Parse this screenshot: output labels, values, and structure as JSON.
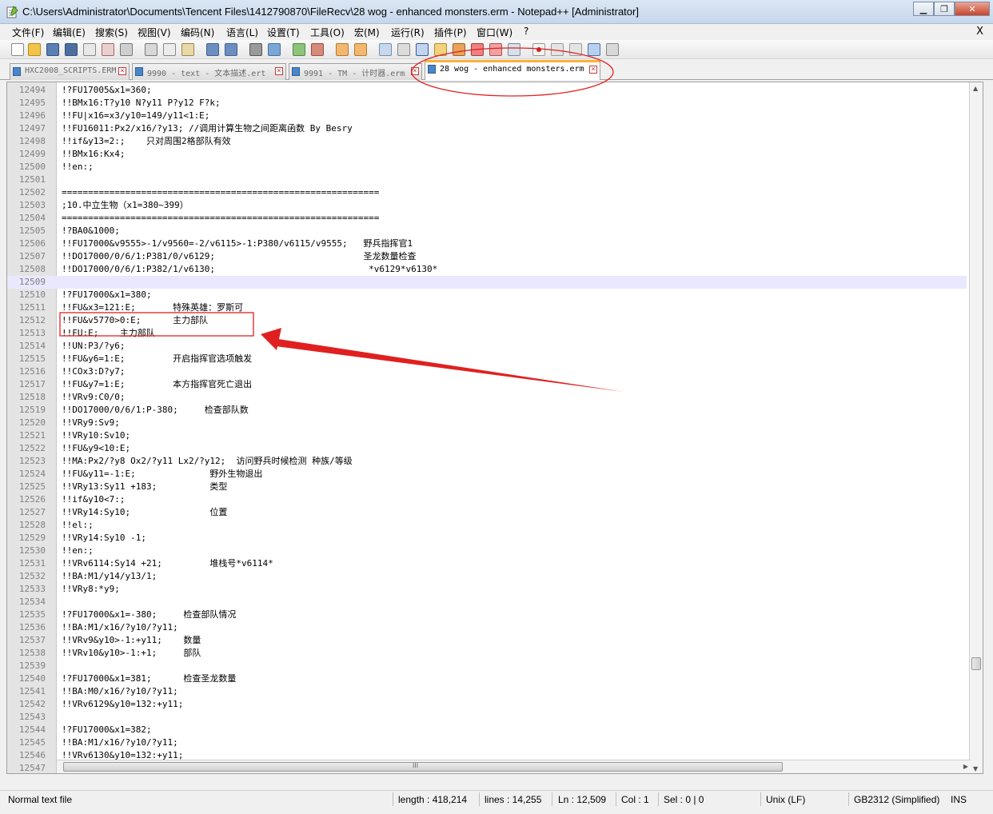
{
  "window": {
    "title": "C:\\Users\\Administrator\\Documents\\Tencent Files\\1412790870\\FileRecv\\28 wog - enhanced monsters.erm - Notepad++ [Administrator]",
    "minimize": "▁",
    "maximize": "❐",
    "close": "✕"
  },
  "menu": {
    "items": [
      "文件(F)",
      "编辑(E)",
      "搜索(S)",
      "视图(V)",
      "编码(N)",
      "语言(L)",
      "设置(T)",
      "工具(O)",
      "宏(M)",
      "运行(R)",
      "插件(P)",
      "窗口(W)",
      "?"
    ],
    "close": "X"
  },
  "tabs": [
    {
      "label": "HXC2008_SCRIPTS.ERM",
      "active": false
    },
    {
      "label": "9990 - text - 文本描述.ert",
      "active": false
    },
    {
      "label": "9991 - TM - 计时器.erm",
      "active": false
    },
    {
      "label": "28 wog - enhanced monsters.erm",
      "active": true
    }
  ],
  "editor": {
    "current_line": 12509,
    "lines": [
      {
        "n": "12494",
        "t": "!?FU17005&x1=360;"
      },
      {
        "n": "12495",
        "t": "!!BMx16:T?y10 N?y11 P?y12 F?k;"
      },
      {
        "n": "12496",
        "t": "!!FU|x16=x3/y10=149/y11<1:E;"
      },
      {
        "n": "12497",
        "t": "!!FU16011:Px2/x16/?y13; //调用计算生物之间距离函数 By Besry"
      },
      {
        "n": "12498",
        "t": "!!if&y13=2:;    只对周围2格部队有效"
      },
      {
        "n": "12499",
        "t": "!!BMx16:Kx4;"
      },
      {
        "n": "12500",
        "t": "!!en:;"
      },
      {
        "n": "12501",
        "t": ""
      },
      {
        "n": "12502",
        "t": "============================================================"
      },
      {
        "n": "12503",
        "t": ";10.中立生物（x1=380~399）"
      },
      {
        "n": "12504",
        "t": "============================================================"
      },
      {
        "n": "12505",
        "t": "!?BA0&1000;"
      },
      {
        "n": "12506",
        "t": "!!FU17000&v9555>-1/v9560=-2/v6115>-1:P380/v6115/v9555;   野兵指挥官1"
      },
      {
        "n": "12507",
        "t": "!!DO17000/0/6/1:P381/0/v6129;                            圣龙数量检查"
      },
      {
        "n": "12508",
        "t": "!!DO17000/0/6/1:P382/1/v6130;                             *v6129*v6130*"
      },
      {
        "n": "12509",
        "t": ""
      },
      {
        "n": "12510",
        "t": "!?FU17000&x1=380;"
      },
      {
        "n": "12511",
        "t": "!!FU&x3=121:E;       特殊英雄：罗斯可"
      },
      {
        "n": "12512",
        "t": "!!FU&v5770>0:E;      主力部队"
      },
      {
        "n": "12513",
        "t": "!!FU:E;    主力部队"
      },
      {
        "n": "12514",
        "t": "!!UN:P3/?y6;"
      },
      {
        "n": "12515",
        "t": "!!FU&y6=1:E;         开启指挥官选项触发"
      },
      {
        "n": "12516",
        "t": "!!COx3:D?y7;"
      },
      {
        "n": "12517",
        "t": "!!FU&y7=1:E;         本方指挥官死亡退出"
      },
      {
        "n": "12518",
        "t": "!!VRv9:C0/0;"
      },
      {
        "n": "12519",
        "t": "!!DO17000/0/6/1:P-380;     检查部队数"
      },
      {
        "n": "12520",
        "t": "!!VRy9:Sv9;"
      },
      {
        "n": "12521",
        "t": "!!VRy10:Sv10;"
      },
      {
        "n": "12522",
        "t": "!!FU&y9<10:E;"
      },
      {
        "n": "12523",
        "t": "!!MA:Px2/?y8 Ox2/?y11 Lx2/?y12;  访问野兵时候检测 种族/等级"
      },
      {
        "n": "12524",
        "t": "!!FU&y11=-1:E;              野外生物退出"
      },
      {
        "n": "12525",
        "t": "!!VRy13:Sy11 +183;          类型"
      },
      {
        "n": "12526",
        "t": "!!if&y10<7:;"
      },
      {
        "n": "12527",
        "t": "!!VRy14:Sy10;               位置"
      },
      {
        "n": "12528",
        "t": "!!el:;"
      },
      {
        "n": "12529",
        "t": "!!VRy14:Sy10 -1;"
      },
      {
        "n": "12530",
        "t": "!!en:;"
      },
      {
        "n": "12531",
        "t": "!!VRv6114:Sy14 +21;         堆栈号*v6114*"
      },
      {
        "n": "12532",
        "t": "!!BA:M1/y14/y13/1;"
      },
      {
        "n": "12533",
        "t": "!!VRy8:*y9;"
      },
      {
        "n": "12534",
        "t": ""
      },
      {
        "n": "12535",
        "t": "!?FU17000&x1=-380;     检查部队情况"
      },
      {
        "n": "12536",
        "t": "!!BA:M1/x16/?y10/?y11;"
      },
      {
        "n": "12537",
        "t": "!!VRv9&y10>-1:+y11;    数量"
      },
      {
        "n": "12538",
        "t": "!!VRv10&y10>-1:+1;     部队"
      },
      {
        "n": "12539",
        "t": ""
      },
      {
        "n": "12540",
        "t": "!?FU17000&x1=381;      检查圣龙数量"
      },
      {
        "n": "12541",
        "t": "!!BA:M0/x16/?y10/?y11;"
      },
      {
        "n": "12542",
        "t": "!!VRv6129&y10=132:+y11;"
      },
      {
        "n": "12543",
        "t": ""
      },
      {
        "n": "12544",
        "t": "!?FU17000&x1=382;"
      },
      {
        "n": "12545",
        "t": "!!BA:M1/x16/?y10/?y11;"
      },
      {
        "n": "12546",
        "t": "!!VRv6130&y10=132:+y11;"
      },
      {
        "n": "12547",
        "t": ""
      }
    ]
  },
  "scroll": {
    "vertical_position": 0.86,
    "up_arrow": "▲",
    "down_arrow": "▼",
    "left_arrow": "◀",
    "right_arrow": "▶",
    "grip": "III"
  },
  "status": {
    "file_type": "Normal text file",
    "length": "length : 418,214",
    "lines": "lines : 14,255",
    "ln": "Ln : 12,509",
    "col": "Col : 1",
    "sel": "Sel : 0 | 0",
    "eol": "Unix (LF)",
    "encoding": "GB2312 (Simplified)",
    "mode": "INS"
  },
  "colors": {
    "annotation": "#e02020",
    "active_tab_accent": "#fbb03b",
    "current_line": "#e8e8ff"
  }
}
